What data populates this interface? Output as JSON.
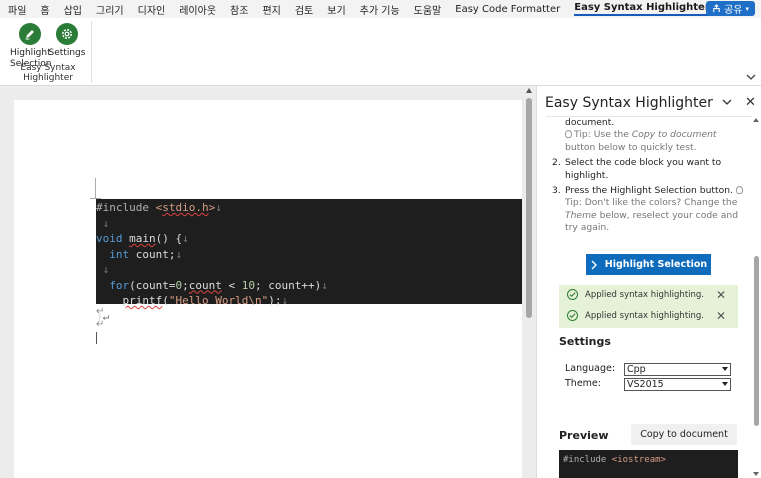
{
  "menu": {
    "items": [
      "파일",
      "홈",
      "삽입",
      "그리기",
      "디자인",
      "레이아웃",
      "참조",
      "편지",
      "검토",
      "보기",
      "추가 기능",
      "도움말",
      "Easy Code Formatter",
      "Easy Syntax Highlighter"
    ],
    "active_index": 13,
    "share_label": "공유"
  },
  "ribbon": {
    "highlight_label_1": "Highlight",
    "highlight_label_2": "Selection",
    "settings_label": "Settings",
    "group_label": "Easy Syntax Highlighter"
  },
  "document": {
    "code_lines": [
      {
        "parts": [
          {
            "t": "#include ",
            "c": "pp"
          },
          {
            "t": "<",
            "c": "str"
          },
          {
            "t": "stdio.h",
            "c": "str sq"
          },
          {
            "t": ">",
            "c": "str"
          },
          {
            "t": "↓",
            "c": "pm"
          }
        ]
      },
      {
        "parts": [
          {
            "t": " ↓",
            "c": "pm"
          }
        ]
      },
      {
        "parts": [
          {
            "t": "void",
            "c": "kw"
          },
          {
            "t": " "
          },
          {
            "t": "main",
            "c": "sq"
          },
          {
            "t": "() {"
          },
          {
            "t": "↓",
            "c": "pm"
          }
        ]
      },
      {
        "parts": [
          {
            "t": "  "
          },
          {
            "t": "int",
            "c": "kw"
          },
          {
            "t": " count;"
          },
          {
            "t": "↓",
            "c": "pm"
          }
        ]
      },
      {
        "parts": [
          {
            "t": " ↓",
            "c": "pm"
          }
        ]
      },
      {
        "parts": [
          {
            "t": "  "
          },
          {
            "t": "for",
            "c": "kw"
          },
          {
            "t": "(count="
          },
          {
            "t": "0",
            "c": "num"
          },
          {
            "t": ";"
          },
          {
            "t": "count",
            "c": "sq"
          },
          {
            "t": " < "
          },
          {
            "t": "10",
            "c": "num"
          },
          {
            "t": "; count++)"
          },
          {
            "t": "↓",
            "c": "pm"
          }
        ]
      },
      {
        "parts": [
          {
            "t": "    "
          },
          {
            "t": "printf",
            "c": "sq"
          },
          {
            "t": "("
          },
          {
            "t": "\"Hello World\\n\"",
            "c": "str"
          },
          {
            "t": ");"
          },
          {
            "t": "↓",
            "c": "pm"
          }
        ]
      },
      {
        "parts": [
          {
            "t": "}"
          },
          {
            "t": "↵",
            "c": "pm"
          }
        ]
      }
    ],
    "after_marks": [
      "↵",
      "↵"
    ]
  },
  "pane": {
    "title": "Easy Syntax Highlighter",
    "step1_tail": "document.",
    "step1_tip_a": "Tip: Use the ",
    "step1_tip_em": "Copy to document",
    "step1_tip_b": " button below to quickly test.",
    "step2_num": "2.",
    "step2_text": "Select the code block you want to highlight.",
    "step3_num": "3.",
    "step3_text": "Press the Highlight Selection button.",
    "step3_tip_a": "Tip: Don't like the colors? Change the ",
    "step3_tip_em": "Theme",
    "step3_tip_b": " below, reselect your code and try again.",
    "highlight_button": "Highlight Selection",
    "notices": [
      "Applied syntax highlighting.",
      "Applied syntax highlighting."
    ],
    "settings_title": "Settings",
    "language_label": "Language:",
    "language_value": "Cpp",
    "theme_label": "Theme:",
    "theme_value": "VS2015",
    "preview_title": "Preview",
    "copy_button": "Copy to document",
    "preview_line1": "#include <iostream>",
    "preview_line1_a": "#include ",
    "preview_line1_b": "<iostream>"
  },
  "colors": {
    "accent": "#0f6cbd",
    "ribbon_icon": "#2a7c36",
    "notice_bg": "#e5f2d8",
    "code_bg": "#1e1e1e"
  }
}
